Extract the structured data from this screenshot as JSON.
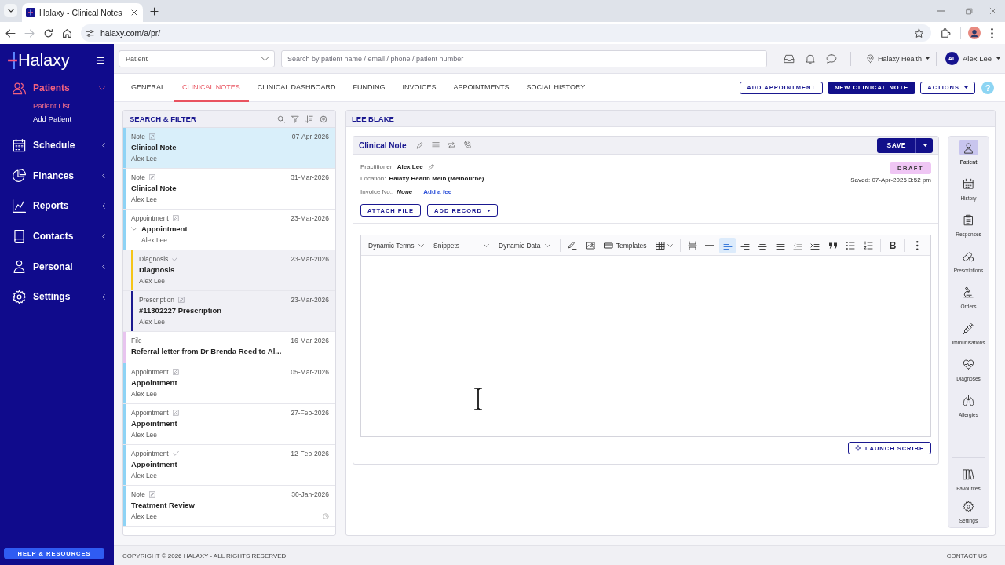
{
  "browser": {
    "tab_title": "Halaxy - Clinical Notes",
    "url": "halaxy.com/a/pr/"
  },
  "sidebar": {
    "logo": "Halaxy",
    "items": [
      {
        "label": "Patients",
        "selected": true,
        "expanded": true,
        "children": [
          {
            "label": "Patient List",
            "selected": true
          },
          {
            "label": "Add Patient",
            "selected": false
          }
        ]
      },
      {
        "label": "Schedule",
        "selected": false,
        "expanded": false
      },
      {
        "label": "Finances",
        "selected": false,
        "expanded": false
      },
      {
        "label": "Reports",
        "selected": false,
        "expanded": false
      },
      {
        "label": "Contacts",
        "selected": false,
        "expanded": false
      },
      {
        "label": "Personal",
        "selected": false,
        "expanded": false
      },
      {
        "label": "Settings",
        "selected": false,
        "expanded": false
      }
    ],
    "help_button": "HELP & RESOURCES"
  },
  "topbar": {
    "patient_select": {
      "value": "Patient"
    },
    "search": {
      "placeholder": "Search by patient name / email / phone / patient number"
    },
    "location": "Halaxy Health",
    "user": {
      "initials": "AL",
      "name": "Alex Lee"
    }
  },
  "tabs": [
    {
      "label": "GENERAL",
      "selected": false
    },
    {
      "label": "CLINICAL NOTES",
      "selected": true
    },
    {
      "label": "CLINICAL DASHBOARD",
      "selected": false
    },
    {
      "label": "FUNDING",
      "selected": false
    },
    {
      "label": "INVOICES",
      "selected": false
    },
    {
      "label": "APPOINTMENTS",
      "selected": false
    },
    {
      "label": "SOCIAL HISTORY",
      "selected": false
    }
  ],
  "header_buttons": [
    {
      "label": "ADD APPOINTMENT",
      "kind": "outline"
    },
    {
      "label": "NEW CLINICAL NOTE",
      "kind": "primary"
    },
    {
      "label": "ACTIONS",
      "kind": "menu"
    }
  ],
  "help": "?",
  "records": {
    "title": "SEARCH & FILTER",
    "items": [
      {
        "type": "Note",
        "finalised": false,
        "date": "07-Apr-2026",
        "title": "Clinical Note",
        "author": "Alex Lee",
        "color": "#8ed3f5",
        "selected": true,
        "reminder": false
      },
      {
        "type": "Note",
        "finalised": false,
        "date": "31-Mar-2026",
        "title": "Clinical Note",
        "author": "Alex Lee",
        "color": "#8ed3f5",
        "selected": false,
        "reminder": false
      },
      {
        "type": "Appointment",
        "finalised": false,
        "date": "23-Mar-2026",
        "title": "Appointment",
        "author": "Alex Lee",
        "color": "#8ed3f5",
        "selected": false,
        "reminder": false,
        "expanded": true,
        "children": [
          {
            "type": "Diagnosis",
            "finalised": true,
            "date": "23-Mar-2026",
            "title": "Diagnosis",
            "author": "Alex Lee",
            "color": "#f5c518",
            "selected": false,
            "reminder": false
          },
          {
            "type": "Prescription",
            "finalised": false,
            "date": "23-Mar-2026",
            "title": "#11302227 Prescription",
            "author": "Alex Lee",
            "color": "#1c1a8f",
            "selected": false,
            "reminder": false
          }
        ]
      },
      {
        "type": "File",
        "date": "16-Mar-2026",
        "title": "Referral letter from Dr Brenda Reed to Al...",
        "color": "#e8c4ef",
        "selected": false,
        "reminder": false
      },
      {
        "type": "Appointment",
        "finalised": false,
        "date": "05-Mar-2026",
        "title": "Appointment",
        "author": "Alex Lee",
        "color": "#8ed3f5",
        "selected": false,
        "reminder": false
      },
      {
        "type": "Appointment",
        "finalised": false,
        "date": "27-Feb-2026",
        "title": "Appointment",
        "author": "Alex Lee",
        "color": "#8ed3f5",
        "selected": false,
        "reminder": false
      },
      {
        "type": "Appointment",
        "finalised": true,
        "date": "12-Feb-2026",
        "title": "Appointment",
        "author": "Alex Lee",
        "color": "#8ed3f5",
        "selected": false,
        "reminder": false
      },
      {
        "type": "Note",
        "finalised": false,
        "date": "30-Jan-2026",
        "title": "Treatment Review",
        "author": "Alex Lee",
        "color": "#8ed3f5",
        "selected": false,
        "reminder": true
      }
    ]
  },
  "patient": {
    "name": "LEE BLAKE"
  },
  "note": {
    "title": "Clinical Note",
    "save": "SAVE",
    "practitioner": {
      "label": "Practitioner:",
      "value": "Alex Lee"
    },
    "location": {
      "label": "Location:",
      "value": "Halaxy Health Melb (Melbourne)"
    },
    "invoice": {
      "label": "Invoice No.:",
      "value": "None",
      "link": "Add a fee"
    },
    "status": "DRAFT",
    "saved": "Saved: 07-Apr-2026 3:52 pm",
    "actions": [
      {
        "label": "ATTACH FILE",
        "kind": "plain"
      },
      {
        "label": "ADD RECORD",
        "kind": "menu"
      }
    ],
    "editor": {
      "menus": [
        "Dynamic Terms",
        "Snippets",
        "Dynamic Data"
      ],
      "templates": "Templates",
      "align": [
        {
          "selected": true
        },
        {
          "selected": false
        },
        {
          "selected": false
        },
        {
          "selected": false
        }
      ],
      "bold": "B"
    },
    "scribe_button": "LAUNCH SCRIBE"
  },
  "side_rail": {
    "items": [
      {
        "label": "Patient",
        "selected": true
      },
      {
        "label": "History",
        "selected": false
      },
      {
        "label": "Responses",
        "selected": false
      },
      {
        "label": "Prescriptions",
        "selected": false
      },
      {
        "label": "Orders",
        "selected": false
      },
      {
        "label": "Immunisations",
        "selected": false
      },
      {
        "label": "Diagnoses",
        "selected": false
      },
      {
        "label": "Allergies",
        "selected": false
      }
    ],
    "bottom_items": [
      "Favourites",
      "Settings"
    ]
  },
  "footer": {
    "copyright": "COPYRIGHT © 2026 HALAXY - ALL RIGHTS RESERVED",
    "contact": "CONTACT US"
  }
}
